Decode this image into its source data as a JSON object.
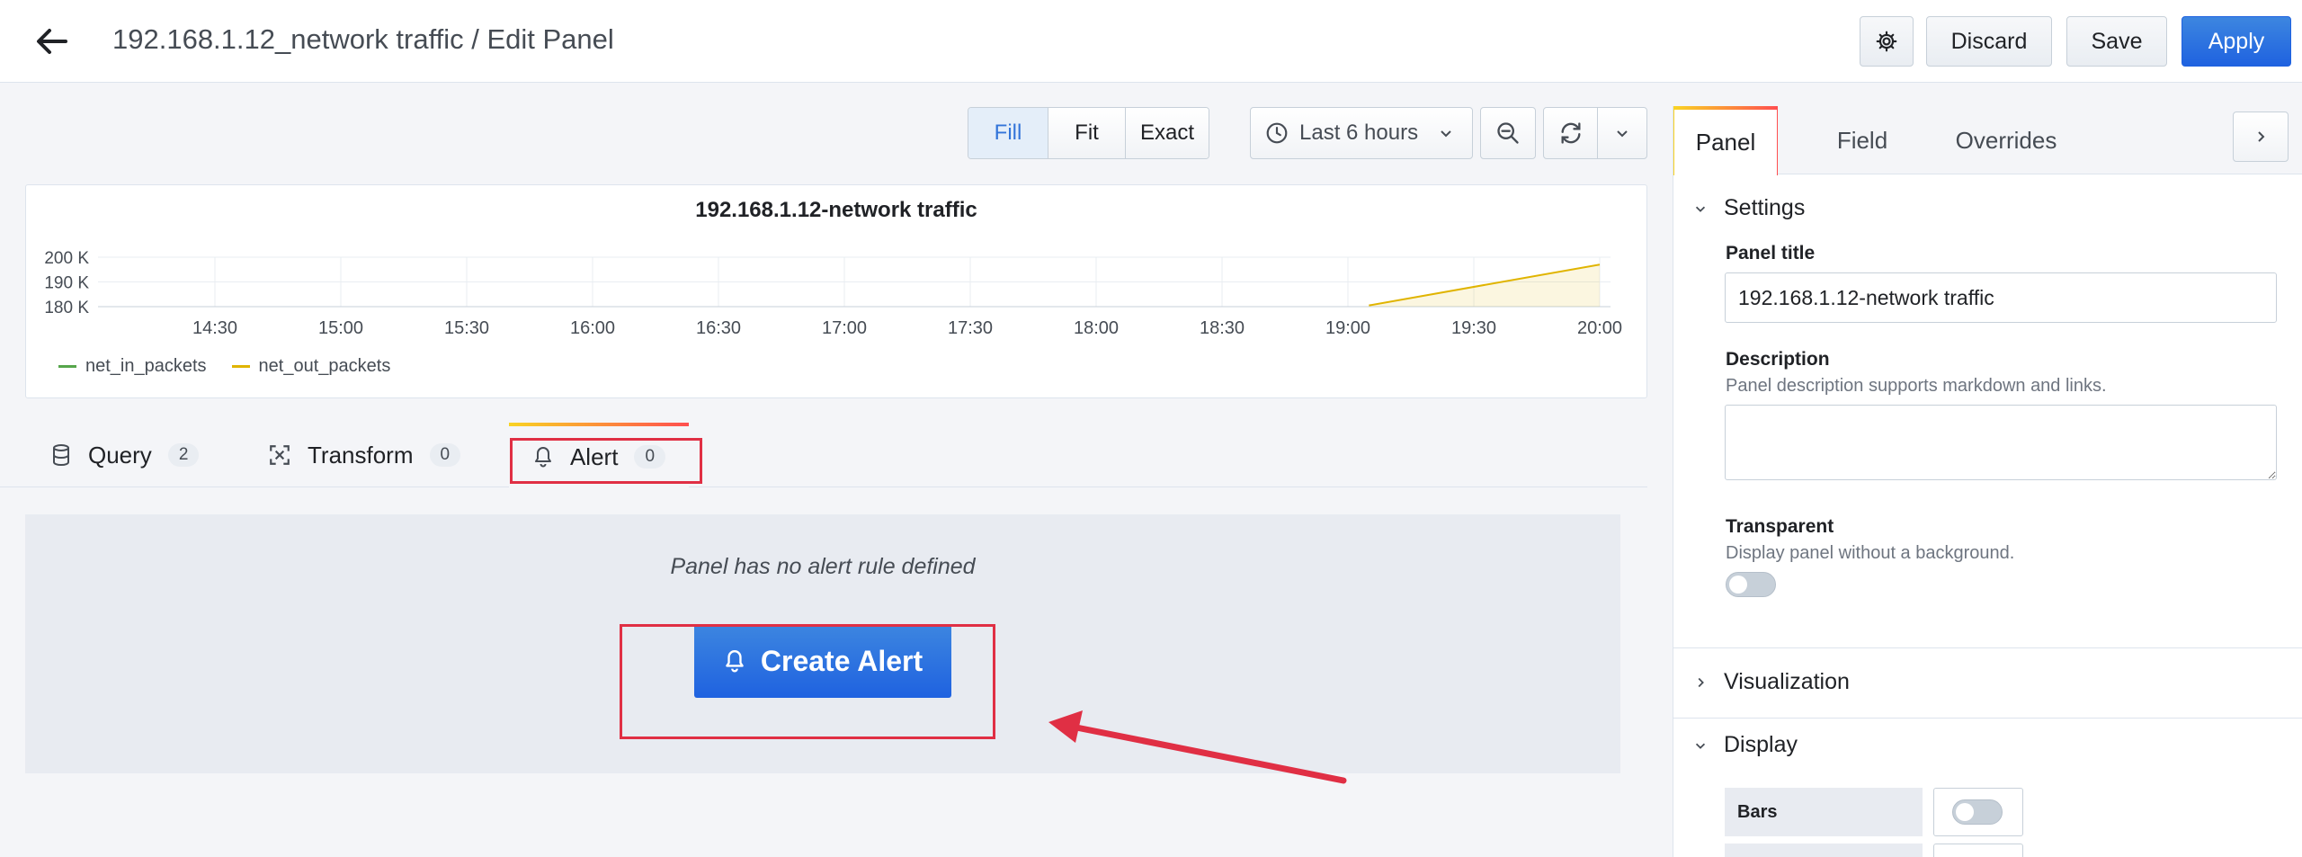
{
  "header": {
    "title": "192.168.1.12_network traffic / Edit Panel",
    "discard_label": "Discard",
    "save_label": "Save",
    "apply_label": "Apply"
  },
  "toolbar": {
    "display_modes": [
      "Fill",
      "Fit",
      "Exact"
    ],
    "active_mode": "Fill",
    "time_range": "Last 6 hours"
  },
  "chart_data": {
    "type": "line",
    "title": "192.168.1.12-network traffic",
    "x_ticks": [
      "14:30",
      "15:00",
      "15:30",
      "16:00",
      "16:30",
      "17:00",
      "17:30",
      "18:00",
      "18:30",
      "19:00",
      "19:30",
      "20:00"
    ],
    "y_ticks": [
      "200 K",
      "190 K",
      "180 K"
    ],
    "ylim": [
      180000,
      200000
    ],
    "series": [
      {
        "name": "net_in_packets",
        "color": "#56a64b",
        "x": [],
        "y": []
      },
      {
        "name": "net_out_packets",
        "color": "#e0b400",
        "x": [
          "19:05",
          "20:00"
        ],
        "y": [
          180500,
          197000
        ],
        "fill": true
      }
    ],
    "legend": "bottom-left",
    "grid": true
  },
  "tabs": [
    {
      "label": "Query",
      "count": "2"
    },
    {
      "label": "Transform",
      "count": "0"
    },
    {
      "label": "Alert",
      "count": "0"
    }
  ],
  "alert": {
    "empty_message": "Panel has no alert rule defined",
    "create_label": "Create Alert"
  },
  "options": {
    "tabs": [
      "Panel",
      "Field",
      "Overrides"
    ],
    "settings": {
      "header": "Settings",
      "panel_title_label": "Panel title",
      "panel_title_value": "192.168.1.12-network traffic",
      "description_label": "Description",
      "description_hint": "Panel description supports markdown and links.",
      "transparent_label": "Transparent",
      "transparent_hint": "Display panel without a background."
    },
    "visualization_header": "Visualization",
    "display_header": "Display",
    "bars_label": "Bars"
  },
  "colors": {
    "primary": "#1f62e0",
    "highlight": "#e02f44",
    "series_out": "#e0b400",
    "series_in": "#56a64b"
  }
}
